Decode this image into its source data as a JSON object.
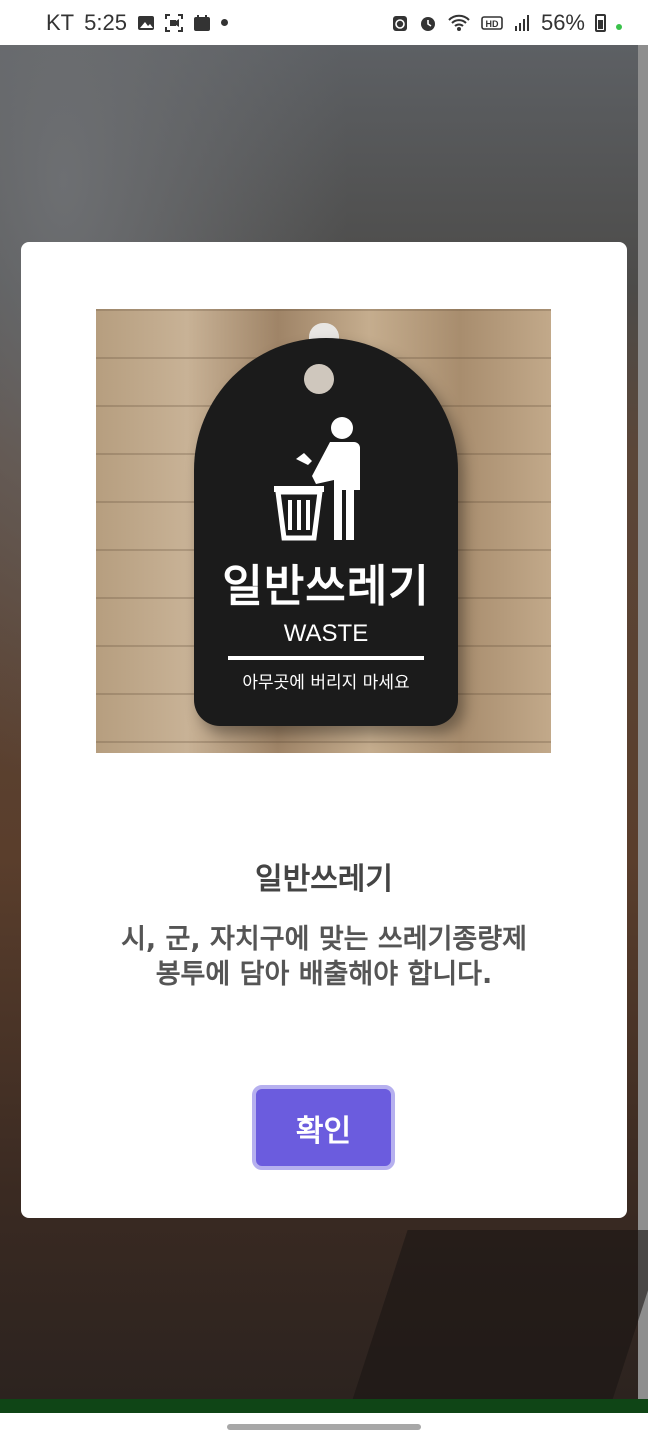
{
  "status_bar": {
    "carrier": "KT",
    "time": "5:25",
    "battery": "56%",
    "icons_left": [
      "image-icon",
      "screen-record-icon",
      "calendar-icon",
      "notification-dot"
    ],
    "icons_right": [
      "recycle-icon",
      "alarm-icon",
      "wifi-icon",
      "hd-icon",
      "signal-icon",
      "battery-icon"
    ]
  },
  "dialog": {
    "image": {
      "sign_title": "일반쓰레기",
      "sign_subtitle": "WASTE",
      "sign_note": "아무곳에 버리지 마세요"
    },
    "title": "일반쓰레기",
    "description_line1": "시, 군, 자치구에 맞는 쓰레기종량제",
    "description_line2": "봉투에 담아 배출해야 합니다.",
    "confirm_label": "확인"
  },
  "colors": {
    "accent": "#6b5cde",
    "accent_border": "#b6b0ef",
    "bottom_bar": "#0f4516"
  }
}
